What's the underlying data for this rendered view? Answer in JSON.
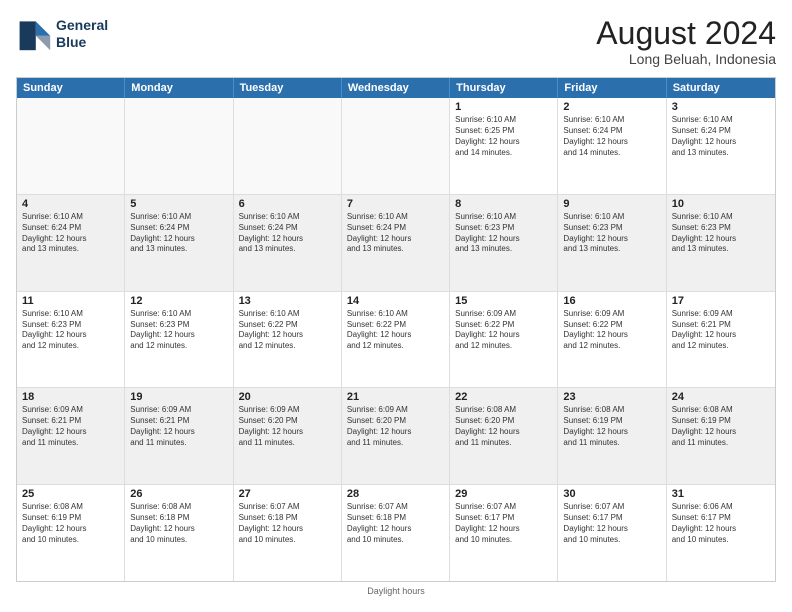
{
  "header": {
    "logo_line1": "General",
    "logo_line2": "Blue",
    "main_title": "August 2024",
    "subtitle": "Long Beluah, Indonesia"
  },
  "calendar": {
    "days": [
      "Sunday",
      "Monday",
      "Tuesday",
      "Wednesday",
      "Thursday",
      "Friday",
      "Saturday"
    ],
    "weeks": [
      [
        {
          "day": "",
          "content": ""
        },
        {
          "day": "",
          "content": ""
        },
        {
          "day": "",
          "content": ""
        },
        {
          "day": "",
          "content": ""
        },
        {
          "day": "1",
          "content": "Sunrise: 6:10 AM\nSunset: 6:25 PM\nDaylight: 12 hours\nand 14 minutes."
        },
        {
          "day": "2",
          "content": "Sunrise: 6:10 AM\nSunset: 6:24 PM\nDaylight: 12 hours\nand 14 minutes."
        },
        {
          "day": "3",
          "content": "Sunrise: 6:10 AM\nSunset: 6:24 PM\nDaylight: 12 hours\nand 13 minutes."
        }
      ],
      [
        {
          "day": "4",
          "content": "Sunrise: 6:10 AM\nSunset: 6:24 PM\nDaylight: 12 hours\nand 13 minutes."
        },
        {
          "day": "5",
          "content": "Sunrise: 6:10 AM\nSunset: 6:24 PM\nDaylight: 12 hours\nand 13 minutes."
        },
        {
          "day": "6",
          "content": "Sunrise: 6:10 AM\nSunset: 6:24 PM\nDaylight: 12 hours\nand 13 minutes."
        },
        {
          "day": "7",
          "content": "Sunrise: 6:10 AM\nSunset: 6:24 PM\nDaylight: 12 hours\nand 13 minutes."
        },
        {
          "day": "8",
          "content": "Sunrise: 6:10 AM\nSunset: 6:23 PM\nDaylight: 12 hours\nand 13 minutes."
        },
        {
          "day": "9",
          "content": "Sunrise: 6:10 AM\nSunset: 6:23 PM\nDaylight: 12 hours\nand 13 minutes."
        },
        {
          "day": "10",
          "content": "Sunrise: 6:10 AM\nSunset: 6:23 PM\nDaylight: 12 hours\nand 13 minutes."
        }
      ],
      [
        {
          "day": "11",
          "content": "Sunrise: 6:10 AM\nSunset: 6:23 PM\nDaylight: 12 hours\nand 12 minutes."
        },
        {
          "day": "12",
          "content": "Sunrise: 6:10 AM\nSunset: 6:23 PM\nDaylight: 12 hours\nand 12 minutes."
        },
        {
          "day": "13",
          "content": "Sunrise: 6:10 AM\nSunset: 6:22 PM\nDaylight: 12 hours\nand 12 minutes."
        },
        {
          "day": "14",
          "content": "Sunrise: 6:10 AM\nSunset: 6:22 PM\nDaylight: 12 hours\nand 12 minutes."
        },
        {
          "day": "15",
          "content": "Sunrise: 6:09 AM\nSunset: 6:22 PM\nDaylight: 12 hours\nand 12 minutes."
        },
        {
          "day": "16",
          "content": "Sunrise: 6:09 AM\nSunset: 6:22 PM\nDaylight: 12 hours\nand 12 minutes."
        },
        {
          "day": "17",
          "content": "Sunrise: 6:09 AM\nSunset: 6:21 PM\nDaylight: 12 hours\nand 12 minutes."
        }
      ],
      [
        {
          "day": "18",
          "content": "Sunrise: 6:09 AM\nSunset: 6:21 PM\nDaylight: 12 hours\nand 11 minutes."
        },
        {
          "day": "19",
          "content": "Sunrise: 6:09 AM\nSunset: 6:21 PM\nDaylight: 12 hours\nand 11 minutes."
        },
        {
          "day": "20",
          "content": "Sunrise: 6:09 AM\nSunset: 6:20 PM\nDaylight: 12 hours\nand 11 minutes."
        },
        {
          "day": "21",
          "content": "Sunrise: 6:09 AM\nSunset: 6:20 PM\nDaylight: 12 hours\nand 11 minutes."
        },
        {
          "day": "22",
          "content": "Sunrise: 6:08 AM\nSunset: 6:20 PM\nDaylight: 12 hours\nand 11 minutes."
        },
        {
          "day": "23",
          "content": "Sunrise: 6:08 AM\nSunset: 6:19 PM\nDaylight: 12 hours\nand 11 minutes."
        },
        {
          "day": "24",
          "content": "Sunrise: 6:08 AM\nSunset: 6:19 PM\nDaylight: 12 hours\nand 11 minutes."
        }
      ],
      [
        {
          "day": "25",
          "content": "Sunrise: 6:08 AM\nSunset: 6:19 PM\nDaylight: 12 hours\nand 10 minutes."
        },
        {
          "day": "26",
          "content": "Sunrise: 6:08 AM\nSunset: 6:18 PM\nDaylight: 12 hours\nand 10 minutes."
        },
        {
          "day": "27",
          "content": "Sunrise: 6:07 AM\nSunset: 6:18 PM\nDaylight: 12 hours\nand 10 minutes."
        },
        {
          "day": "28",
          "content": "Sunrise: 6:07 AM\nSunset: 6:18 PM\nDaylight: 12 hours\nand 10 minutes."
        },
        {
          "day": "29",
          "content": "Sunrise: 6:07 AM\nSunset: 6:17 PM\nDaylight: 12 hours\nand 10 minutes."
        },
        {
          "day": "30",
          "content": "Sunrise: 6:07 AM\nSunset: 6:17 PM\nDaylight: 12 hours\nand 10 minutes."
        },
        {
          "day": "31",
          "content": "Sunrise: 6:06 AM\nSunset: 6:17 PM\nDaylight: 12 hours\nand 10 minutes."
        }
      ]
    ]
  },
  "footer": {
    "note": "Daylight hours"
  }
}
